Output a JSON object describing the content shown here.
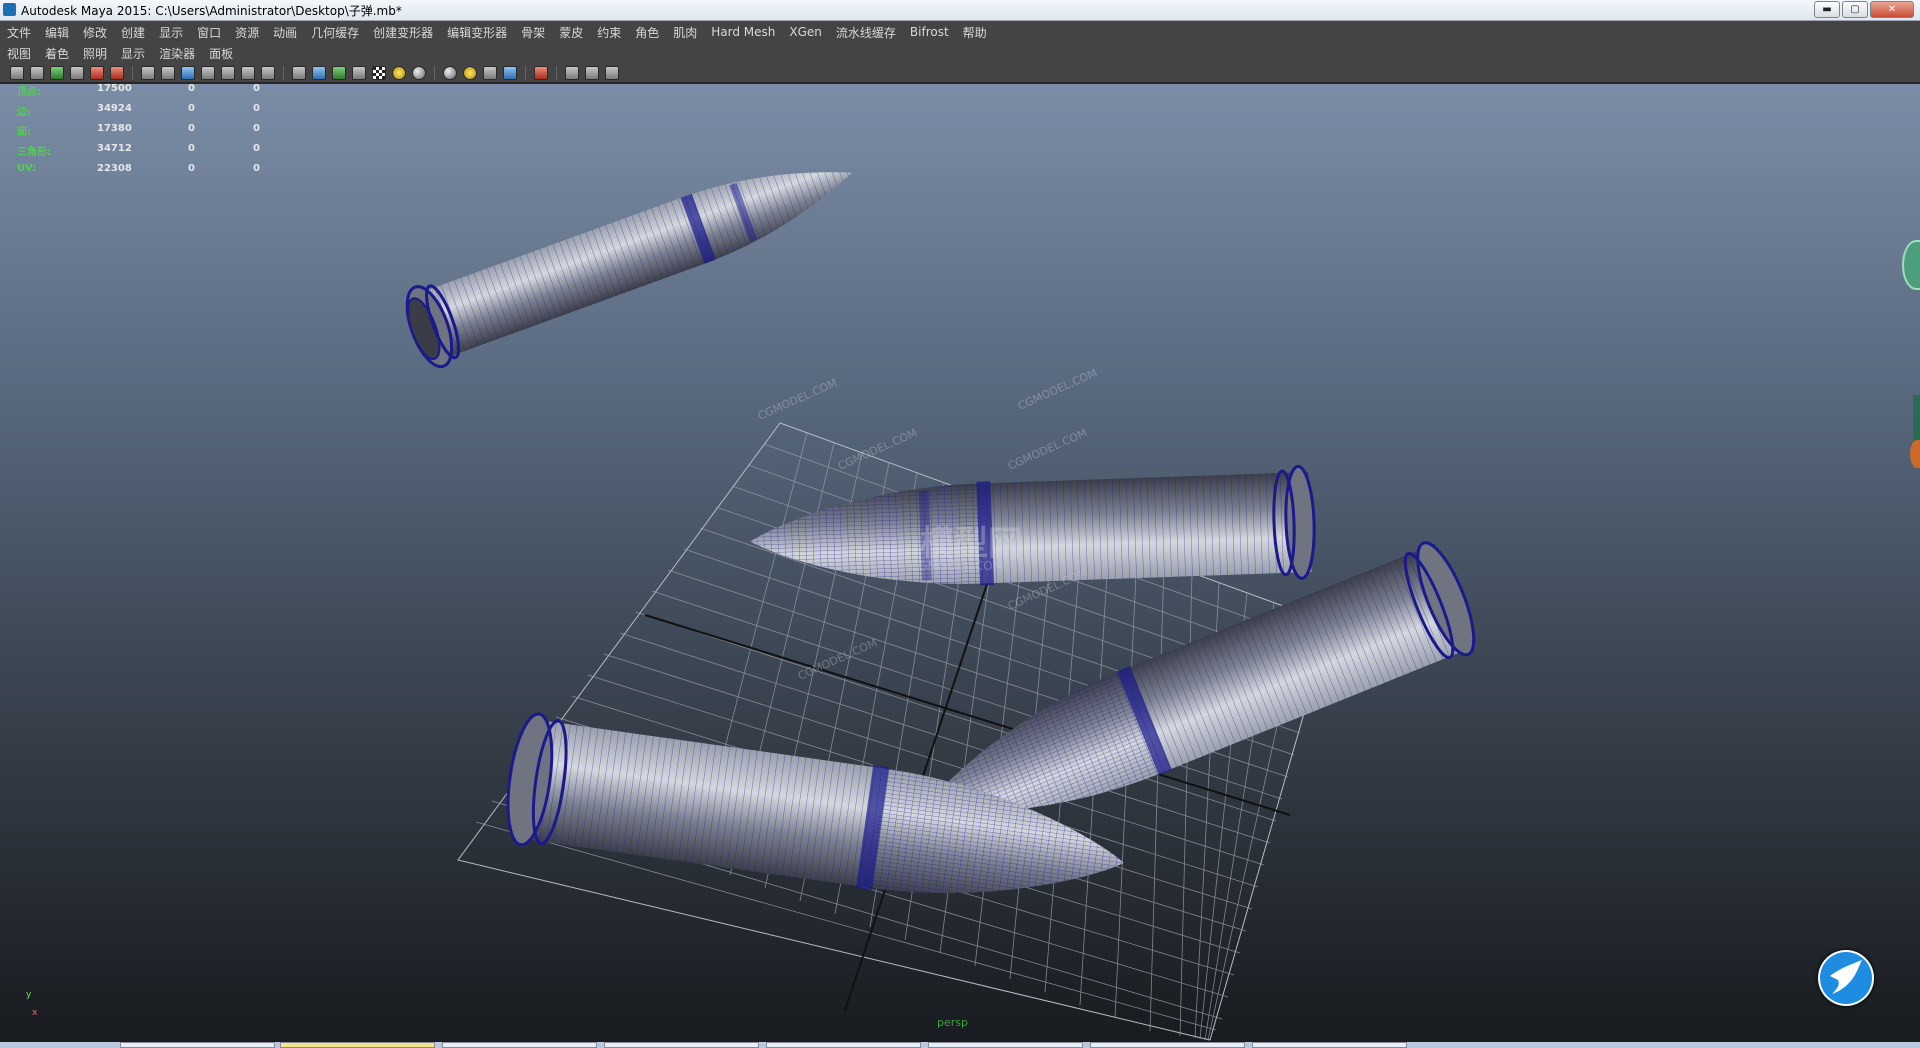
{
  "window": {
    "title": "Autodesk Maya 2015: C:\\Users\\Administrator\\Desktop\\子弹.mb*",
    "minimize_glyph": "▬",
    "maximize_glyph": "▢",
    "close_glyph": "✕"
  },
  "menubar": {
    "items": [
      "文件",
      "编辑",
      "修改",
      "创建",
      "显示",
      "窗口",
      "资源",
      "动画",
      "几何缓存",
      "创建变形器",
      "编辑变形器",
      "骨架",
      "蒙皮",
      "约束",
      "角色",
      "肌肉",
      "Hard Mesh",
      "XGen",
      "流水线缓存",
      "Bifrost",
      "帮助"
    ]
  },
  "panel_menu": {
    "items": [
      "视图",
      "着色",
      "照明",
      "显示",
      "渲染器",
      "面板"
    ]
  },
  "toolbar": {
    "icons": [
      "camera-select-icon",
      "camera-attributes-icon",
      "bookmark-icon",
      "image-plane-icon",
      "grid-icon",
      "film-gate-icon",
      "resolution-gate-icon",
      "wireframe-icon",
      "smooth-shade-icon",
      "textured-icon",
      "lights-icon",
      "shadows-icon",
      "xray-icon",
      "isolate-select-icon"
    ]
  },
  "hud": {
    "rows": [
      {
        "label": "顶点:",
        "values": [
          "17500",
          "0",
          "0"
        ]
      },
      {
        "label": "边:",
        "values": [
          "34924",
          "0",
          "0"
        ]
      },
      {
        "label": "面:",
        "values": [
          "17380",
          "0",
          "0"
        ]
      },
      {
        "label": "三角形:",
        "values": [
          "34712",
          "0",
          "0"
        ]
      },
      {
        "label": "UV:",
        "values": [
          "22308",
          "0",
          "0"
        ]
      }
    ]
  },
  "viewport": {
    "camera": "persp",
    "axis_y": "y",
    "axis_x": "x",
    "watermark_logo": "模型网",
    "watermark_url": "CGMODEL.COM",
    "colors": {
      "bg_top": "#7b8da6",
      "bg_bottom": "#181b1f",
      "wire": "#1a1a8c",
      "mesh": "#7a7f8c"
    }
  }
}
